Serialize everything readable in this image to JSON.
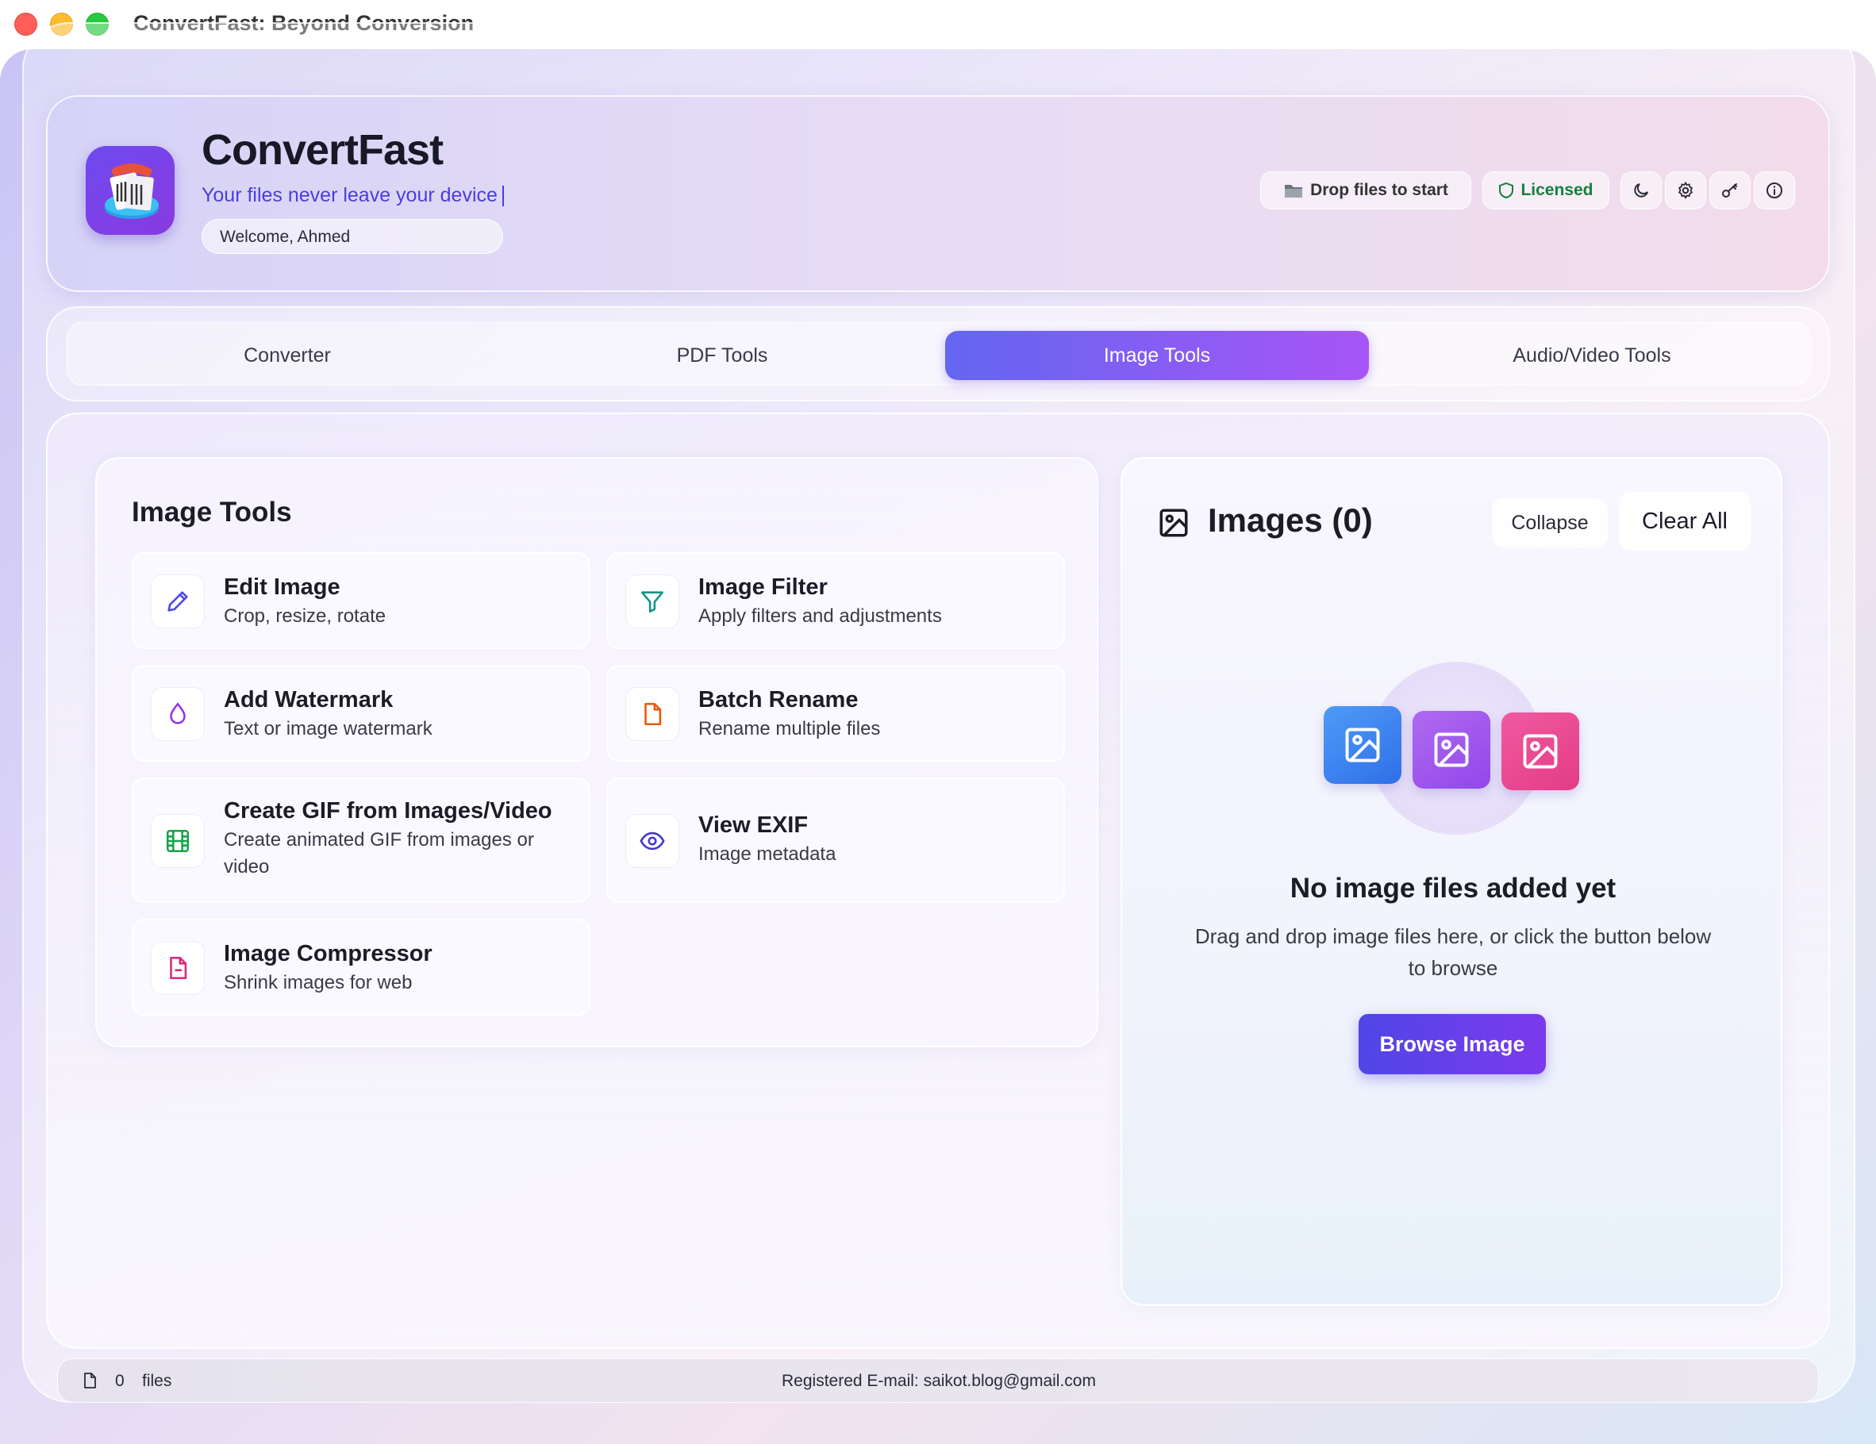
{
  "window": {
    "title": "ConvertFast: Beyond Conversion"
  },
  "header": {
    "app_name": "ConvertFast",
    "tagline": "Your files never leave your device",
    "welcome": "Welcome, Ahmed",
    "drop_label": "Drop files to start",
    "license_label": "Licensed",
    "icons": [
      "moon-icon",
      "gear-icon",
      "key-icon",
      "info-icon"
    ]
  },
  "tabs": [
    {
      "label": "Converter",
      "active": false
    },
    {
      "label": "PDF Tools",
      "active": false
    },
    {
      "label": "Image Tools",
      "active": true
    },
    {
      "label": "Audio/Video Tools",
      "active": false
    }
  ],
  "tools_panel": {
    "title": "Image Tools",
    "tools": [
      {
        "title": "Edit Image",
        "desc": "Crop, resize, rotate",
        "icon": "pencil-icon",
        "color": "#4f46e5"
      },
      {
        "title": "Image Filter",
        "desc": "Apply filters and adjustments",
        "icon": "filter-icon",
        "color": "#0d9488"
      },
      {
        "title": "Add Watermark",
        "desc": "Text or image watermark",
        "icon": "droplet-icon",
        "color": "#9333ea"
      },
      {
        "title": "Batch Rename",
        "desc": "Rename multiple files",
        "icon": "file-icon",
        "color": "#ea580c"
      },
      {
        "title": "Create GIF from Images/Video",
        "desc": "Create animated GIF from images or video",
        "icon": "film-icon",
        "color": "#16a34a"
      },
      {
        "title": "View EXIF",
        "desc": "Image metadata",
        "icon": "eye-icon",
        "color": "#4338ca"
      },
      {
        "title": "Image Compressor",
        "desc": "Shrink images for web",
        "icon": "file-minus-icon",
        "color": "#db2777"
      }
    ]
  },
  "images_panel": {
    "title": "Images (0)",
    "collapse_label": "Collapse",
    "clear_label": "Clear All",
    "empty_title": "No image files added yet",
    "empty_desc": "Drag and drop image files here, or click the button below to browse",
    "browse_label": "Browse Image"
  },
  "statusbar": {
    "count": "0",
    "files_label": "files",
    "email_text": "Registered E-mail: saikot.blog@gmail.com"
  },
  "colors": {
    "accent_start": "#6366f1",
    "accent_end": "#a855f7",
    "licensed": "#15803d",
    "tagline": "#4a3ee0"
  }
}
